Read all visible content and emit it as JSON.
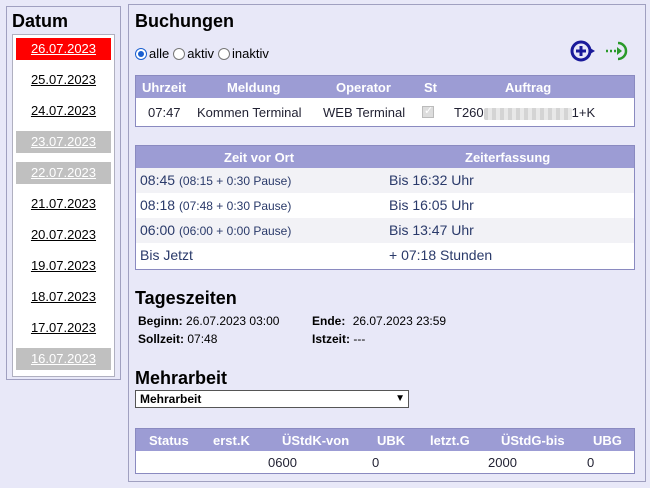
{
  "datum": {
    "title": "Datum",
    "dates": [
      {
        "label": "26.07.2023",
        "state": "selected"
      },
      {
        "label": "25.07.2023",
        "state": "normal"
      },
      {
        "label": "24.07.2023",
        "state": "normal"
      },
      {
        "label": "23.07.2023",
        "state": "weekend"
      },
      {
        "label": "22.07.2023",
        "state": "weekend"
      },
      {
        "label": "21.07.2023",
        "state": "normal"
      },
      {
        "label": "20.07.2023",
        "state": "normal"
      },
      {
        "label": "19.07.2023",
        "state": "normal"
      },
      {
        "label": "18.07.2023",
        "state": "normal"
      },
      {
        "label": "17.07.2023",
        "state": "normal"
      },
      {
        "label": "16.07.2023",
        "state": "weekend"
      }
    ]
  },
  "buchungen": {
    "title": "Buchungen",
    "filter": {
      "alle": "alle",
      "aktiv": "aktiv",
      "inaktiv": "inaktiv",
      "selected": "alle"
    },
    "icons": {
      "add": "add-booking-icon",
      "login": "login-arrow-icon"
    },
    "columns": [
      "Uhrzeit",
      "Meldung",
      "Operator",
      "St",
      "Auftrag"
    ],
    "rows": [
      {
        "uhrzeit": "07:47",
        "meldung": "Kommen Terminal",
        "operator": "WEB Terminal",
        "st_checked": true,
        "auftrag_prefix": "T260",
        "auftrag_suffix": "1+K"
      }
    ]
  },
  "zeit": {
    "columns": [
      "Zeit vor Ort",
      "Zeiterfassung"
    ],
    "rows": [
      {
        "zeit": "08:45",
        "detail": "(08:15 + 0:30 Pause)",
        "erfassung": "Bis 16:32 Uhr"
      },
      {
        "zeit": "08:18",
        "detail": "(07:48 + 0:30 Pause)",
        "erfassung": "Bis 16:05 Uhr"
      },
      {
        "zeit": "06:00",
        "detail": "(06:00 + 0:00 Pause)",
        "erfassung": "Bis 13:47 Uhr"
      },
      {
        "zeit": "Bis Jetzt",
        "detail": "",
        "erfassung": "+ 07:18 Stunden"
      }
    ]
  },
  "tageszeiten": {
    "title": "Tageszeiten",
    "beginn_label": "Beginn:",
    "beginn_value": "26.07.2023 03:00",
    "ende_label": "Ende:",
    "ende_value": "26.07.2023 23:59",
    "sollzeit_label": "Sollzeit:",
    "sollzeit_value": "07:48",
    "istzeit_label": "Istzeit:",
    "istzeit_value": "---"
  },
  "mehrarbeit": {
    "title": "Mehrarbeit",
    "select_value": "Mehrarbeit",
    "columns": [
      "Status",
      "erst.K",
      "ÜStdK-von",
      "UBK",
      "letzt.G",
      "ÜStdG-bis",
      "UBG"
    ],
    "row": [
      "",
      "",
      "0600",
      "0",
      "",
      "2000",
      "0"
    ]
  },
  "colors": {
    "accent": "#9c9cd4",
    "selected_date": "#ff0000",
    "weekend_date": "#c0c0c0",
    "background": "#e8e8f8"
  }
}
